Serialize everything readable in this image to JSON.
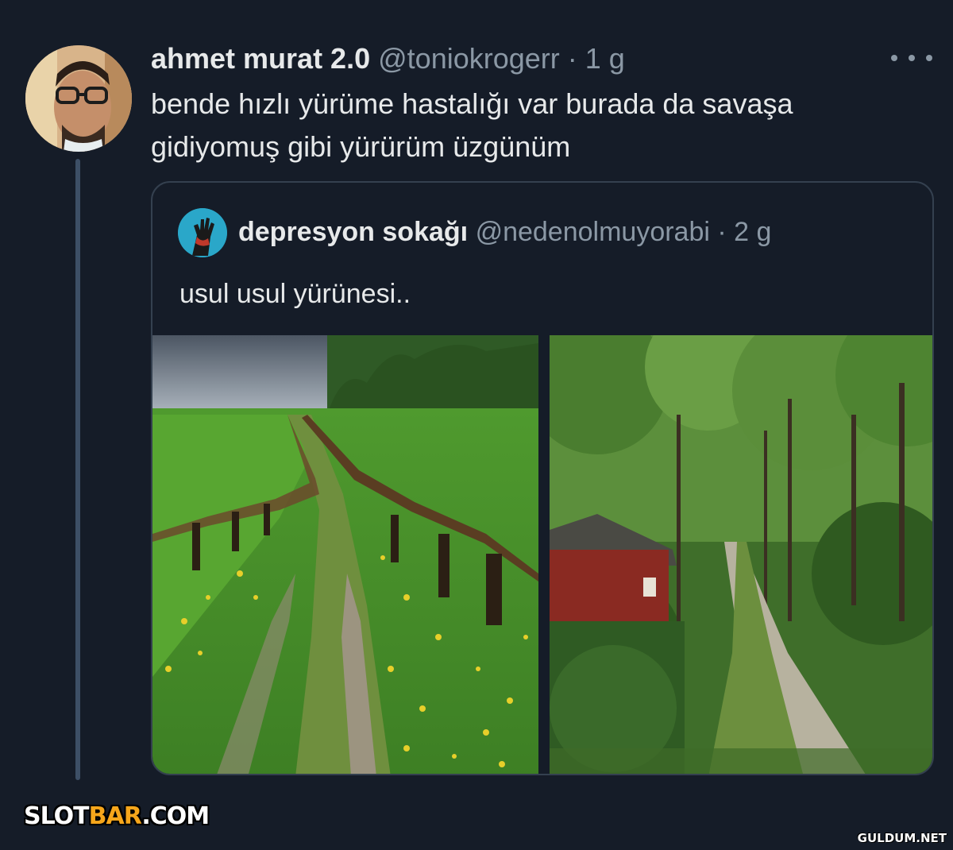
{
  "tweet": {
    "author_name": "ahmet murat 2.0",
    "handle": "@toniokrogerr",
    "separator": " · ",
    "time": "1 g",
    "text": "bende hızlı yürüme hastalığı var burada da savaşa gidiyomuş gibi yürürüm üzgünüm",
    "avatar_icon": "profile-photo"
  },
  "quoted_tweet": {
    "author_name": "depresyon sokağı",
    "handle": "@nedenolmuyorabi",
    "separator": " · ",
    "time": "2 g",
    "text": "usul usul yürünesi..",
    "avatar_icon": "raised-hand-illustration",
    "media": [
      {
        "name": "meadow-fence-path-photo"
      },
      {
        "name": "forest-path-red-cabin-photo"
      }
    ]
  },
  "watermarks": {
    "left_part1": "SLOT",
    "left_part2": "BAR",
    "left_part3": ".COM",
    "right": "GULDUM.NET"
  },
  "colors": {
    "background": "#151c28",
    "text": "#e7e9ea",
    "muted": "#8b98a5",
    "border": "#34404f",
    "watermark_accent": "#f6a61b"
  }
}
